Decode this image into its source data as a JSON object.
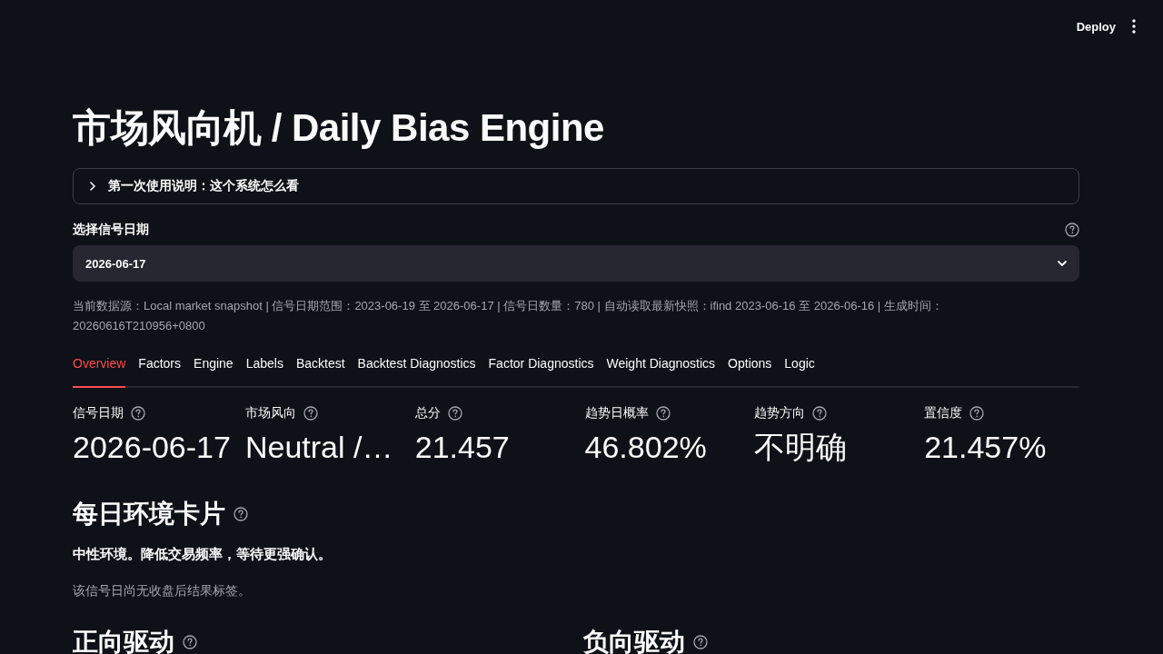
{
  "header": {
    "deploy_button": "Deploy"
  },
  "title": "市场风向机 / Daily Bias Engine",
  "expander": {
    "label": "第一次使用说明：这个系统怎么看",
    "expanded": false
  },
  "date_select": {
    "label": "选择信号日期",
    "value": "2026-06-17"
  },
  "caption": "当前数据源：Local market snapshot | 信号日期范围：2023-06-19 至 2026-06-17 | 信号日数量：780 | 自动读取最新快照：ifind 2023-06-16 至 2026-06-16 | 生成时间：20260616T210956+0800",
  "tabs": [
    {
      "label": "Overview",
      "selected": true
    },
    {
      "label": "Factors",
      "selected": false
    },
    {
      "label": "Engine",
      "selected": false
    },
    {
      "label": "Labels",
      "selected": false
    },
    {
      "label": "Backtest",
      "selected": false
    },
    {
      "label": "Backtest Diagnostics",
      "selected": false
    },
    {
      "label": "Factor Diagnostics",
      "selected": false
    },
    {
      "label": "Weight Diagnostics",
      "selected": false
    },
    {
      "label": "Options",
      "selected": false
    },
    {
      "label": "Logic",
      "selected": false
    }
  ],
  "metrics": [
    {
      "label": "信号日期",
      "value": "2026-06-17"
    },
    {
      "label": "市场风向",
      "value": "Neutral /…"
    },
    {
      "label": "总分",
      "value": "21.457"
    },
    {
      "label": "趋势日概率",
      "value": "46.802%"
    },
    {
      "label": "趋势方向",
      "value": "不明确"
    },
    {
      "label": "置信度",
      "value": "21.457%"
    }
  ],
  "daily_card": {
    "heading": "每日环境卡片",
    "summary": "中性环境。降低交易频率，等待更强确认。",
    "note": "该信号日尚无收盘后结果标签。"
  },
  "drivers": [
    {
      "heading": "正向驱动"
    },
    {
      "heading": "负向驱动"
    }
  ]
}
